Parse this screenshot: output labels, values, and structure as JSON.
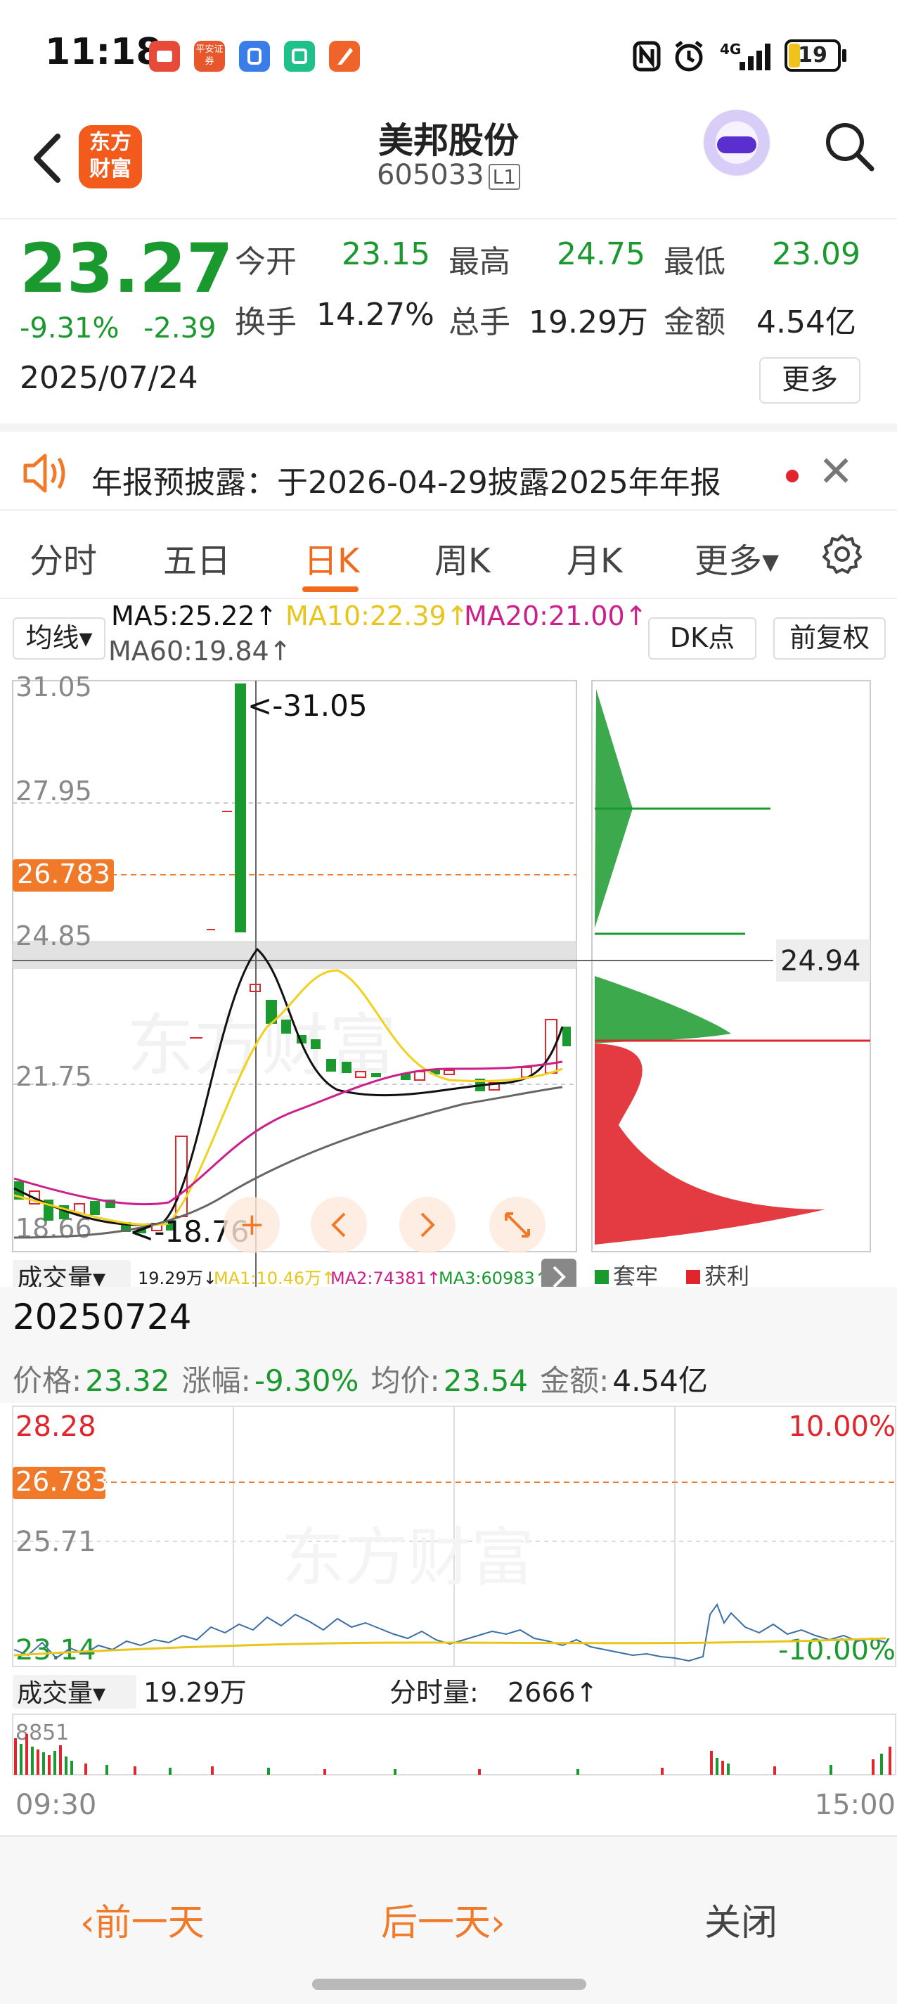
{
  "status_bar": {
    "time": "11:18",
    "battery": "19",
    "network": "4G",
    "app_icons": [
      {
        "name": "video-app-icon",
        "color": "#e84a3a",
        "label": ""
      },
      {
        "name": "securities-app-icon",
        "color": "#e8572c",
        "label": "平安证券"
      },
      {
        "name": "blue-app-icon",
        "color": "#3a7de8",
        "label": ""
      },
      {
        "name": "green-app-icon",
        "color": "#20c08a",
        "label": ""
      },
      {
        "name": "flag-app-icon",
        "color": "#f0642a",
        "label": ""
      }
    ]
  },
  "header": {
    "logo_line1": "东方",
    "logo_line2": "财富",
    "stock_name": "美邦股份",
    "stock_code": "605033",
    "level_badge": "L1"
  },
  "quote": {
    "price": "23.27",
    "change_pct": "-9.31%",
    "change": "-2.39",
    "date": "2025/07/24",
    "open_label": "今开",
    "open": "23.15",
    "high_label": "最高",
    "high": "24.75",
    "low_label": "最低",
    "low": "23.09",
    "turnover_label": "换手",
    "turnover": "14.27%",
    "volume_label": "总手",
    "volume": "19.29万",
    "amount_label": "金额",
    "amount": "4.54亿",
    "more_label": "更多"
  },
  "notice": {
    "text": "年报预披露：于2026-04-29披露2025年年报"
  },
  "tabs": {
    "items": [
      "分时",
      "五日",
      "日K",
      "周K",
      "月K",
      "更多▾"
    ],
    "active_index": 2
  },
  "kline": {
    "indicator_select": "均线▾",
    "ma5": "MA5:25.22↑",
    "ma10": "MA10:22.39↑",
    "ma20": "MA20:21.00↑",
    "ma60": "MA60:19.84↑",
    "dk_button": "DK点",
    "adjust_button": "前复权",
    "price_labels": [
      "31.05",
      "27.95",
      "24.85",
      "21.75",
      "18.66"
    ],
    "current_line_label": "26.783",
    "max_annotation": "<-31.05",
    "min_annotation": "<-18.76",
    "crosshair_value": "24.94",
    "volume_select": "成交量▾",
    "volume_value": "19.29万↓",
    "vol_ma1": "MA1:10.46万↑",
    "vol_ma2": "MA2:74381↑",
    "vol_ma3": "MA3:60983↑",
    "legend_trapped": "套牢",
    "legend_profit": "获利",
    "colors": {
      "ma5": "#111111",
      "ma10": "#f2d01e",
      "ma20": "#cc1f8a",
      "ma60": "#555555",
      "up": "#e0262c",
      "down": "#1a9a2e"
    }
  },
  "detail": {
    "date": "20250724",
    "price_label": "价格:",
    "price": "23.32",
    "change_label": "涨幅:",
    "change": "-9.30%",
    "avg_label": "均价:",
    "avg": "23.54",
    "amount_label": "金额:",
    "amount": "4.54亿",
    "y_top": "28.28",
    "y_ref": "26.783",
    "y_mid": "25.71",
    "y_bottom": "23.14",
    "pct_top": "10.00%",
    "pct_bottom": "-10.00%",
    "vol_select": "成交量▾",
    "vol_total": "19.29万",
    "vol_minute_label": "分时量:",
    "vol_minute": "2666↑",
    "vol_max": "8851",
    "time_start": "09:30",
    "time_end": "15:00"
  },
  "bottom": {
    "prev_day": "‹前一天",
    "next_day": "后一天›",
    "close": "关闭"
  }
}
